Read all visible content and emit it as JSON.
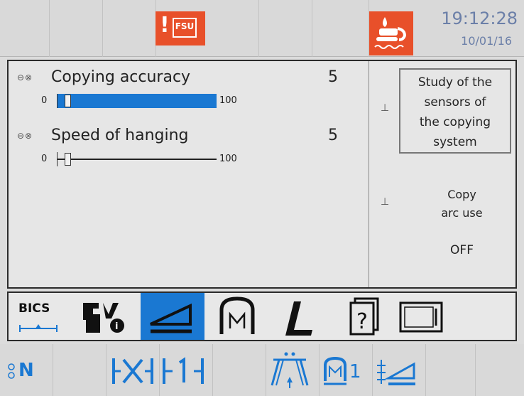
{
  "status_bar": {
    "alarm_text": "FSU",
    "alarm_mark": "!",
    "alarm_icon": "fsu-alarm-icon",
    "lubrication_icon": "lubrication-alarm-icon",
    "time": "19:12:28",
    "date": "10/01/16",
    "alarm_color": "#e8502a"
  },
  "parameters": [
    {
      "label": "Copying accuracy",
      "value": "5",
      "min": "0",
      "max": "100",
      "level": 0.05,
      "selected": true
    },
    {
      "label": "Speed of hanging",
      "value": "5",
      "min": "0",
      "max": "100",
      "level": 0.05,
      "selected": false
    }
  ],
  "side_panel": {
    "sensor_button": [
      "Study of the",
      "sensors of",
      "the copying",
      "system"
    ],
    "copy_line1": "Copy",
    "copy_line2": "arc use",
    "copy_state": "OFF"
  },
  "tabs": {
    "bics_label": "BICS",
    "items": [
      "bics-tab",
      "machine-diagnostics-tab",
      "copying-tab",
      "mould-tab",
      "profile-tab",
      "help-tab",
      "display-tab"
    ],
    "active": "copying-tab",
    "active_color": "#1a78d2"
  },
  "softkeys": {
    "n_label": "N",
    "mould_index": "1",
    "items": [
      "n-softkey",
      "clamp-x-softkey",
      "clamp-1-softkey",
      "tower-softkey",
      "mould-1-softkey",
      "copy-adjust-softkey"
    ]
  }
}
